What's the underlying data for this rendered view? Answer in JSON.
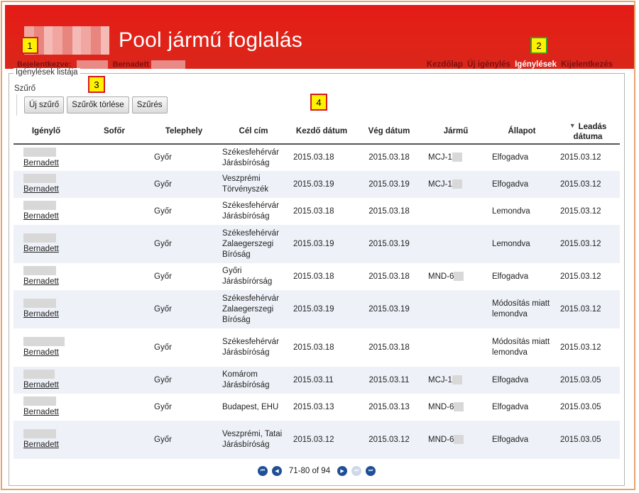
{
  "header": {
    "title": "Pool jármű foglalás",
    "login_label": "Bejelentkezve:",
    "user_name": "Bernadett",
    "brand_color": "#e41b17"
  },
  "nav": [
    {
      "label": "Kezdőlap",
      "active": false
    },
    {
      "label": "Új igénylés",
      "active": false
    },
    {
      "label": "Igénylések",
      "active": true
    },
    {
      "label": "Kijelentkezés",
      "active": false
    }
  ],
  "callouts": [
    "1",
    "2",
    "3",
    "4"
  ],
  "panel": {
    "legend": "Igénylések listája",
    "filter_label": "Szűrő",
    "buttons": {
      "new_filter": "Új szűrő",
      "clear_filters": "Szűrők törlése",
      "filter": "Szűrés"
    }
  },
  "table": {
    "columns": [
      "Igénylő",
      "Sofőr",
      "Telephely",
      "Cél cím",
      "Kezdő dátum",
      "Vég dátum",
      "Jármű",
      "Állapot",
      "Leadás dátuma"
    ],
    "rows": [
      {
        "requester": "Bernadett",
        "driver": "",
        "site": "Győr",
        "destination": "Székesfehérvár Járásbíróság",
        "start": "2015.03.18",
        "end": "2015.03.18",
        "vehicle": "MCJ-1",
        "status": "Elfogadva",
        "submitted": "2015.03.12"
      },
      {
        "requester": "Bernadett",
        "driver": "",
        "site": "Győr",
        "destination": "Veszprémi Törvényszék",
        "start": "2015.03.19",
        "end": "2015.03.19",
        "vehicle": "MCJ-1",
        "status": "Elfogadva",
        "submitted": "2015.03.12"
      },
      {
        "requester": "Bernadett",
        "driver": "",
        "site": "Győr",
        "destination": "Székesfehérvár Járásbíróság",
        "start": "2015.03.18",
        "end": "2015.03.18",
        "vehicle": "",
        "status": "Lemondva",
        "submitted": "2015.03.12"
      },
      {
        "requester": "Bernadett",
        "driver": "",
        "site": "Győr",
        "destination": "Székesfehérvár Zalaegerszegi Bíróság",
        "start": "2015.03.19",
        "end": "2015.03.19",
        "vehicle": "",
        "status": "Lemondva",
        "submitted": "2015.03.12"
      },
      {
        "requester": "Bernadett",
        "driver": "",
        "site": "Győr",
        "destination": "Győri Járásbírórság",
        "start": "2015.03.18",
        "end": "2015.03.18",
        "vehicle": "MND-6",
        "status": "Elfogadva",
        "submitted": "2015.03.12"
      },
      {
        "requester": "Bernadett",
        "driver": "",
        "site": "Győr",
        "destination": "Székesfehérvár Zalaegerszegi Bíróság",
        "start": "2015.03.19",
        "end": "2015.03.19",
        "vehicle": "",
        "status": "Módosítás miatt lemondva",
        "submitted": "2015.03.12"
      },
      {
        "requester": "Bernadett",
        "driver": "",
        "site": "Győr",
        "destination": "Székesfehérvár Járásbíróság",
        "start": "2015.03.18",
        "end": "2015.03.18",
        "vehicle": "",
        "status": "Módosítás miatt lemondva",
        "submitted": "2015.03.12"
      },
      {
        "requester": "Bernadett",
        "driver": "",
        "site": "Győr",
        "destination": "Komárom Járásbíróság",
        "start": "2015.03.11",
        "end": "2015.03.11",
        "vehicle": "MCJ-1",
        "status": "Elfogadva",
        "submitted": "2015.03.05"
      },
      {
        "requester": "Bernadett",
        "driver": "",
        "site": "Győr",
        "destination": "Budapest, EHU",
        "start": "2015.03.13",
        "end": "2015.03.13",
        "vehicle": "MND-6",
        "status": "Elfogadva",
        "submitted": "2015.03.05"
      },
      {
        "requester": "Bernadett",
        "driver": "",
        "site": "Győr",
        "destination": "Veszprémi, Tatai Járásbíróság",
        "start": "2015.03.12",
        "end": "2015.03.12",
        "vehicle": "MND-6",
        "status": "Elfogadva",
        "submitted": "2015.03.05"
      }
    ]
  },
  "pager": {
    "info": "71-80 of 94"
  }
}
